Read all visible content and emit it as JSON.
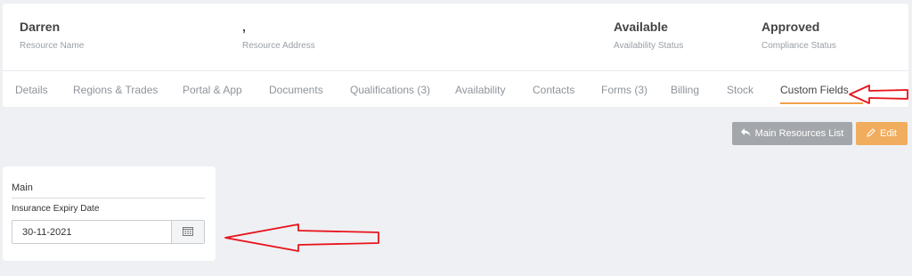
{
  "summary": [
    {
      "value": "Darren",
      "label": "Resource Name"
    },
    {
      "value": ",",
      "label": "Resource Address"
    },
    {
      "value": "Available",
      "label": "Availability Status"
    },
    {
      "value": "Approved",
      "label": "Compliance Status"
    }
  ],
  "tabs": [
    {
      "label": "Details"
    },
    {
      "label": "Regions & Trades"
    },
    {
      "label": "Portal & App"
    },
    {
      "label": "Documents"
    },
    {
      "label": "Qualifications (3)"
    },
    {
      "label": "Availability"
    },
    {
      "label": "Contacts"
    },
    {
      "label": "Forms (3)"
    },
    {
      "label": "Billing"
    },
    {
      "label": "Stock"
    },
    {
      "label": "Custom Fields",
      "active": true
    }
  ],
  "toolbar": {
    "main_list_label": "Main Resources List",
    "edit_label": "Edit"
  },
  "form": {
    "section_title": "Main",
    "insurance_label": "Insurance Expiry Date",
    "insurance_value": "30-11-2021"
  },
  "colors": {
    "accent": "#f0a04b",
    "edit_button": "#f0ad5e",
    "secondary_button": "#a3a6aa",
    "annotation": "#e8141b"
  },
  "icons": {
    "main_list": "reply-icon",
    "edit": "pencil-icon",
    "calendar": "calendar-icon"
  }
}
